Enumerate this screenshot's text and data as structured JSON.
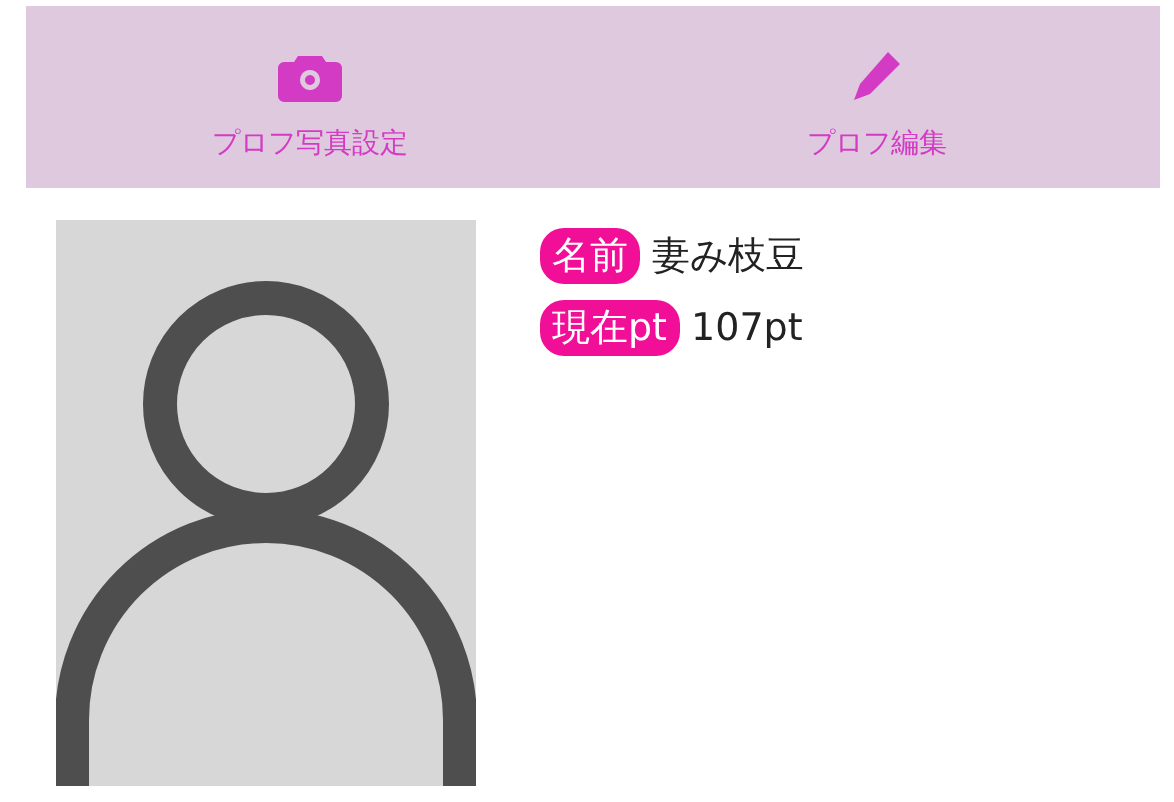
{
  "toolbar": [
    {
      "kind": "camera",
      "label": "プロフ写真設定"
    },
    {
      "kind": "pencil",
      "label": "プロフ編集"
    }
  ],
  "profile": {
    "avatar": {
      "kind": "silhouette"
    },
    "fields": [
      {
        "label": "名前",
        "value": "妻み枝豆"
      },
      {
        "label": "現在pt",
        "value": "107pt"
      }
    ]
  }
}
